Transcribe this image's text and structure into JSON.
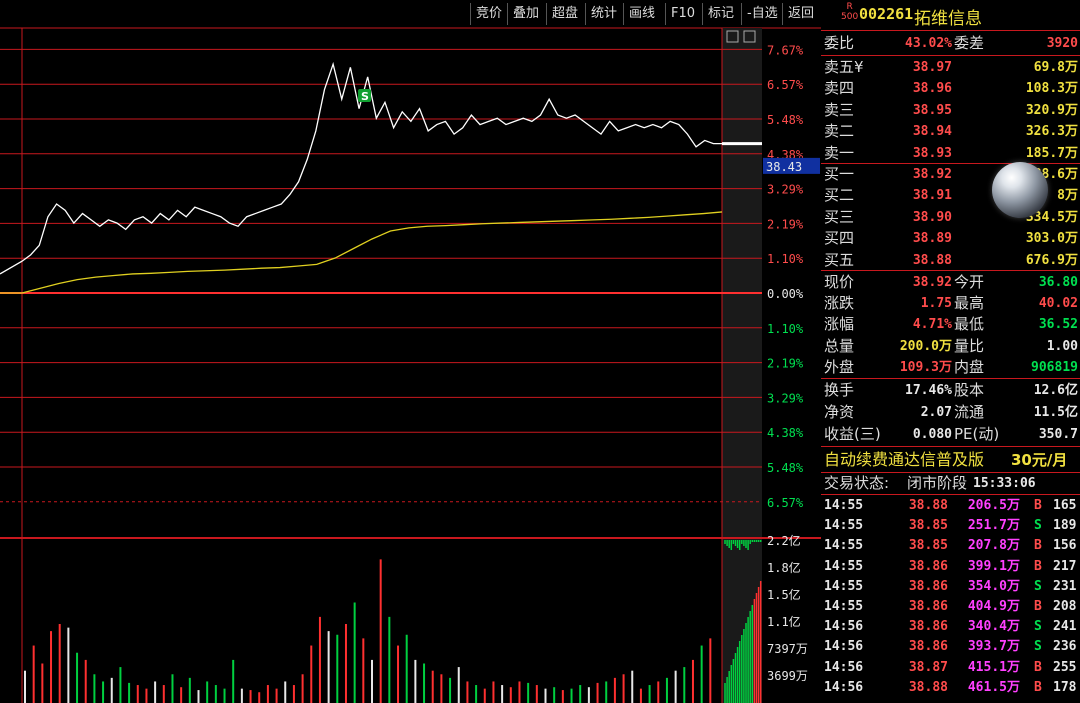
{
  "toolbar": [
    "竞价",
    "叠加",
    "超盘",
    "统计",
    "画线",
    "F10",
    "标记",
    "-自选",
    "返回"
  ],
  "stock": {
    "badge_top": "R",
    "badge_bottom": "500",
    "code": "002261",
    "name": "拓维信息"
  },
  "order_ratio": {
    "label1": "委比",
    "value1": "43.02%",
    "label2": "委差",
    "value2": "3920"
  },
  "asks": [
    {
      "label": "卖五",
      "mark": "¥",
      "price": "38.97",
      "vol": "69.8万"
    },
    {
      "label": "卖四",
      "mark": "",
      "price": "38.96",
      "vol": "108.3万"
    },
    {
      "label": "卖三",
      "mark": "",
      "price": "38.95",
      "vol": "320.9万"
    },
    {
      "label": "卖二",
      "mark": "",
      "price": "38.94",
      "vol": "326.3万"
    },
    {
      "label": "卖一",
      "mark": "",
      "price": "38.93",
      "vol": "185.7万"
    }
  ],
  "bids": [
    {
      "label": "买一",
      "price": "38.92",
      "vol": "38.6万"
    },
    {
      "label": "买二",
      "price": "38.91",
      "vol": "8万"
    },
    {
      "label": "买三",
      "price": "38.90",
      "vol": "334.5万"
    },
    {
      "label": "买四",
      "price": "38.89",
      "vol": "303.0万"
    },
    {
      "label": "买五",
      "price": "38.88",
      "vol": "676.9万"
    }
  ],
  "quote": [
    {
      "l1": "现价",
      "v1": "38.92",
      "c1": "red",
      "l2": "今开",
      "v2": "36.80",
      "c2": "green"
    },
    {
      "l1": "涨跌",
      "v1": "1.75",
      "c1": "red",
      "l2": "最高",
      "v2": "40.02",
      "c2": "red"
    },
    {
      "l1": "涨幅",
      "v1": "4.71%",
      "c1": "red",
      "l2": "最低",
      "v2": "36.52",
      "c2": "green"
    },
    {
      "l1": "总量",
      "v1": "200.0万",
      "c1": "yellow",
      "l2": "量比",
      "v2": "1.00",
      "c2": "white"
    },
    {
      "l1": "外盘",
      "v1": "109.3万",
      "c1": "red",
      "l2": "内盘",
      "v2": "906819",
      "c2": "green"
    }
  ],
  "fundamentals": [
    {
      "l1": "换手",
      "v1": "17.46%",
      "l2": "股本",
      "v2": "12.6亿"
    },
    {
      "l1": "净资",
      "v1": "2.07",
      "l2": "流通",
      "v2": "11.5亿"
    },
    {
      "l1": "收益(三)",
      "v1": "0.080",
      "l2": "PE(动)",
      "v2": "350.7"
    }
  ],
  "promo": {
    "text": "自动续费通达信普及版",
    "price": "30元/月"
  },
  "trade_status": {
    "label": "交易状态:",
    "value": "闭市阶段",
    "time": "15:33:06"
  },
  "ticks": [
    {
      "time": "14:55",
      "price": "38.88",
      "vol": "206.5万",
      "side": "B",
      "num": "165"
    },
    {
      "time": "14:55",
      "price": "38.85",
      "vol": "251.7万",
      "side": "S",
      "num": "189"
    },
    {
      "time": "14:55",
      "price": "38.85",
      "vol": "207.8万",
      "side": "B",
      "num": "156"
    },
    {
      "time": "14:55",
      "price": "38.86",
      "vol": "399.1万",
      "side": "B",
      "num": "217"
    },
    {
      "time": "14:55",
      "price": "38.86",
      "vol": "354.0万",
      "side": "S",
      "num": "231"
    },
    {
      "time": "14:55",
      "price": "38.86",
      "vol": "404.9万",
      "side": "B",
      "num": "208"
    },
    {
      "time": "14:56",
      "price": "38.86",
      "vol": "340.4万",
      "side": "S",
      "num": "241"
    },
    {
      "time": "14:56",
      "price": "38.86",
      "vol": "393.7万",
      "side": "S",
      "num": "236"
    },
    {
      "time": "14:56",
      "price": "38.87",
      "vol": "415.1万",
      "side": "B",
      "num": "255"
    },
    {
      "time": "14:56",
      "price": "38.88",
      "vol": "461.5万",
      "side": "B",
      "num": "178"
    }
  ],
  "chart_data": {
    "type": "line",
    "price_label": "38.43",
    "pct_ticks_up": [
      "7.67%",
      "6.57%",
      "5.48%",
      "4.38%",
      "3.29%",
      "2.19%",
      "1.10%"
    ],
    "pct_zero": "0.00%",
    "pct_ticks_down": [
      "1.10%",
      "2.19%",
      "3.29%",
      "4.38%",
      "5.48%",
      "6.57%"
    ],
    "vol_ticks": [
      "2.2亿",
      "1.8亿",
      "1.5亿",
      "1.1亿",
      "7397万",
      "3699万"
    ],
    "ylim_pct": [
      -7.67,
      7.67
    ],
    "signal_marker": "S",
    "price_pct": [
      1.0,
      1.2,
      1.5,
      2.4,
      2.8,
      2.6,
      2.2,
      2.5,
      2.3,
      2.1,
      2.3,
      2.2,
      2.0,
      2.3,
      2.4,
      2.2,
      2.5,
      2.3,
      2.6,
      2.4,
      2.7,
      2.6,
      2.5,
      2.4,
      2.2,
      2.1,
      2.4,
      2.5,
      2.6,
      2.7,
      2.8,
      3.1,
      3.5,
      4.2,
      5.1,
      6.4,
      7.2,
      6.1,
      7.1,
      5.8,
      6.8,
      5.5,
      6.0,
      5.2,
      5.7,
      5.4,
      5.8,
      5.1,
      5.3,
      5.4,
      5.0,
      5.2,
      5.6,
      5.3,
      5.4,
      5.5,
      5.3,
      5.4,
      5.5,
      5.4,
      5.6,
      6.1,
      5.6,
      5.5,
      5.6,
      5.4,
      5.2,
      5.0,
      5.4,
      5.1,
      5.2,
      5.3,
      5.2,
      5.3,
      5.2,
      5.4,
      5.3,
      5.0,
      4.6,
      4.8,
      4.7,
      4.7
    ],
    "avg_pct": [
      0.0,
      0.15,
      0.3,
      0.42,
      0.5,
      0.55,
      0.6,
      0.62,
      0.65,
      0.68,
      0.7,
      0.72,
      0.75,
      0.78,
      0.8,
      0.85,
      0.9,
      1.1,
      1.4,
      1.7,
      1.95,
      2.05,
      2.1,
      2.12,
      2.15,
      2.18,
      2.2,
      2.22,
      2.24,
      2.26,
      2.28,
      2.3,
      2.32,
      2.35,
      2.38,
      2.42,
      2.46,
      2.5,
      2.55
    ],
    "volumes_m": [
      45,
      80,
      55,
      100,
      110,
      105,
      70,
      60,
      40,
      30,
      35,
      50,
      28,
      25,
      20,
      30,
      25,
      40,
      22,
      35,
      18,
      30,
      25,
      20,
      60,
      20,
      18,
      15,
      25,
      20,
      30,
      25,
      40,
      80,
      120,
      100,
      95,
      110,
      140,
      90,
      60,
      200,
      120,
      80,
      95,
      60,
      55,
      45,
      40,
      35,
      50,
      30,
      25,
      20,
      30,
      25,
      22,
      30,
      28,
      25,
      20,
      22,
      18,
      20,
      25,
      22,
      28,
      30,
      35,
      40,
      45,
      20,
      25,
      30,
      35,
      45,
      50,
      60,
      80,
      90
    ]
  }
}
